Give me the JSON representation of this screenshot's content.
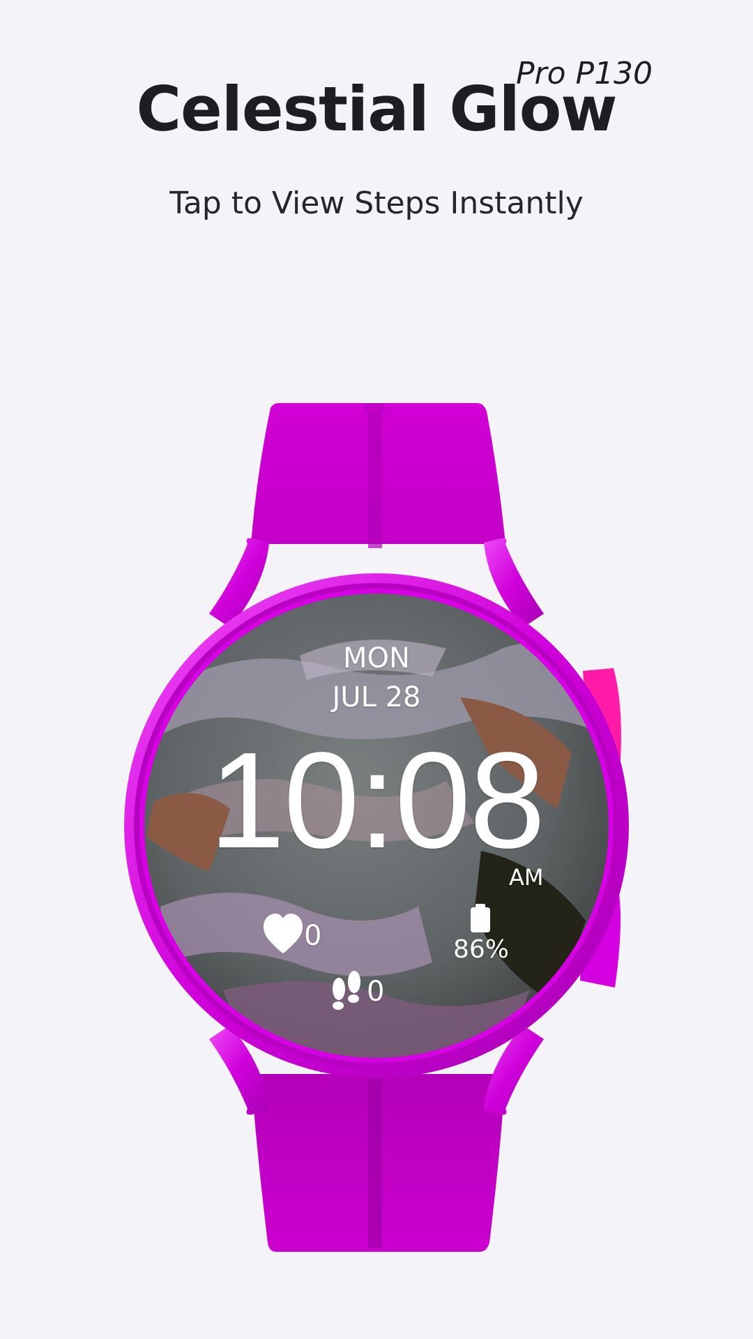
{
  "header": {
    "title": "Celestial Glow",
    "model": "Pro P130",
    "subtitle": "Tap to View Steps Instantly"
  },
  "watch_face": {
    "day": "MON",
    "date": "JUL 28",
    "time": "10:08",
    "ampm": "AM",
    "heart_rate": "0",
    "steps": "0",
    "battery": "86%",
    "battery_level": 0.86,
    "icons": [
      "heart-icon",
      "footsteps-icon",
      "battery-icon"
    ]
  },
  "colors": {
    "background": "#f4f4f8",
    "strap": "#cc00cc",
    "case": "#e000e8",
    "text": "#1e1e22",
    "side_button": "#ff0099"
  }
}
